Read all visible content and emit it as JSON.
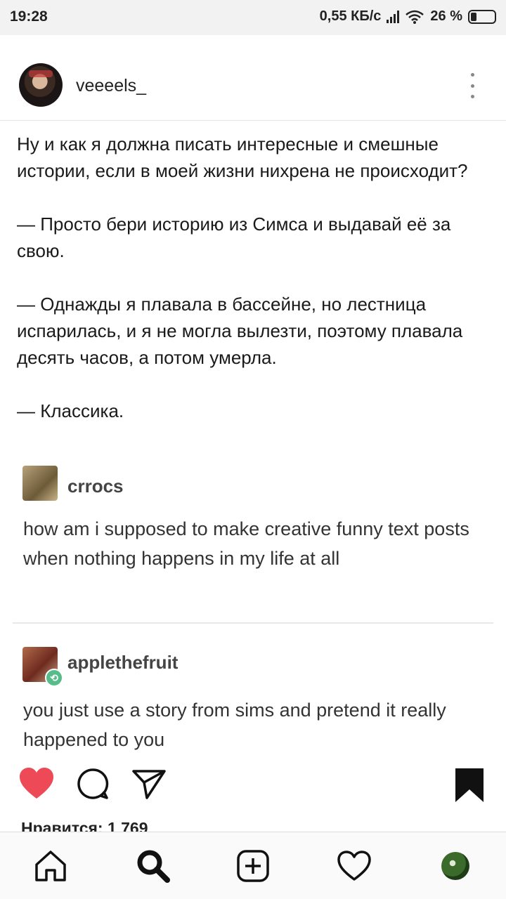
{
  "status_bar": {
    "time": "19:28",
    "speed": "0,55 КБ/с",
    "battery": "26 %",
    "icons": [
      "signal-icon",
      "wifi-icon",
      "battery-icon"
    ]
  },
  "post": {
    "username": "veeeels_",
    "caption": [
      "Ну и как я должна писать интересные и смешные истории, если в моей жизни нихрена не происходит?",
      "— Просто бери историю из Симса и выдавай её за свою.",
      "— Однажды я плавала в бассейне, но лестница испарилась, и я не могла вылезти, поэтому плавала десять часов, а потом умерла.",
      "— Классика."
    ],
    "image": {
      "posts": [
        {
          "name": "crrocs",
          "text": "how am i supposed to make creative funny text posts when nothing happens in my life at all"
        },
        {
          "name": "applethefruit",
          "text": "you just use a story from sims and pretend it really happened to you"
        }
      ]
    },
    "likes": "Нравится: 1 769"
  },
  "colors": {
    "heart": "#ed4956",
    "text": "#262626",
    "reblog": "#56bc8a"
  },
  "nav": [
    "home-icon",
    "search-icon",
    "new-post-icon",
    "activity-icon",
    "profile-avatar"
  ]
}
